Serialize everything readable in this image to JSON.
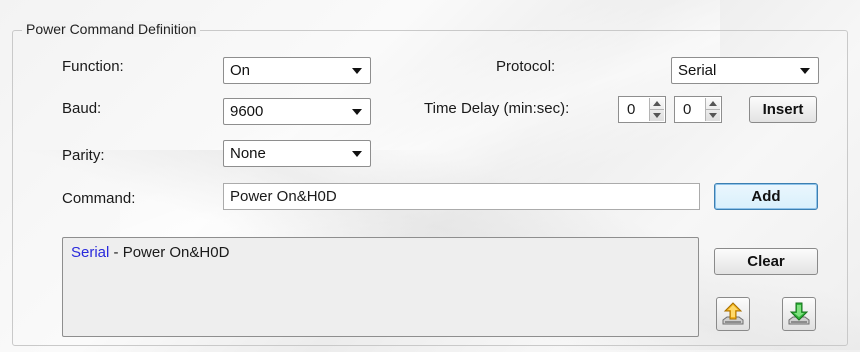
{
  "group": {
    "title": "Power Command Definition"
  },
  "function": {
    "label": "Function:",
    "value": "On"
  },
  "baud": {
    "label": "Baud:",
    "value": "9600"
  },
  "parity": {
    "label": "Parity:",
    "value": "None"
  },
  "protocol": {
    "label": "Protocol:",
    "value": "Serial"
  },
  "time_delay": {
    "label": "Time Delay (min:sec):",
    "minutes": "0",
    "seconds": "0"
  },
  "command": {
    "label": "Command:",
    "value": "Power On&H0D"
  },
  "buttons": {
    "insert": "Insert",
    "add": "Add",
    "clear": "Clear"
  },
  "list": {
    "items": [
      {
        "protocol": "Serial",
        "separator": " - ",
        "command": "Power On&H0D"
      }
    ]
  },
  "icons": {
    "upload": "upload-arrow-icon",
    "download": "download-arrow-icon"
  }
}
